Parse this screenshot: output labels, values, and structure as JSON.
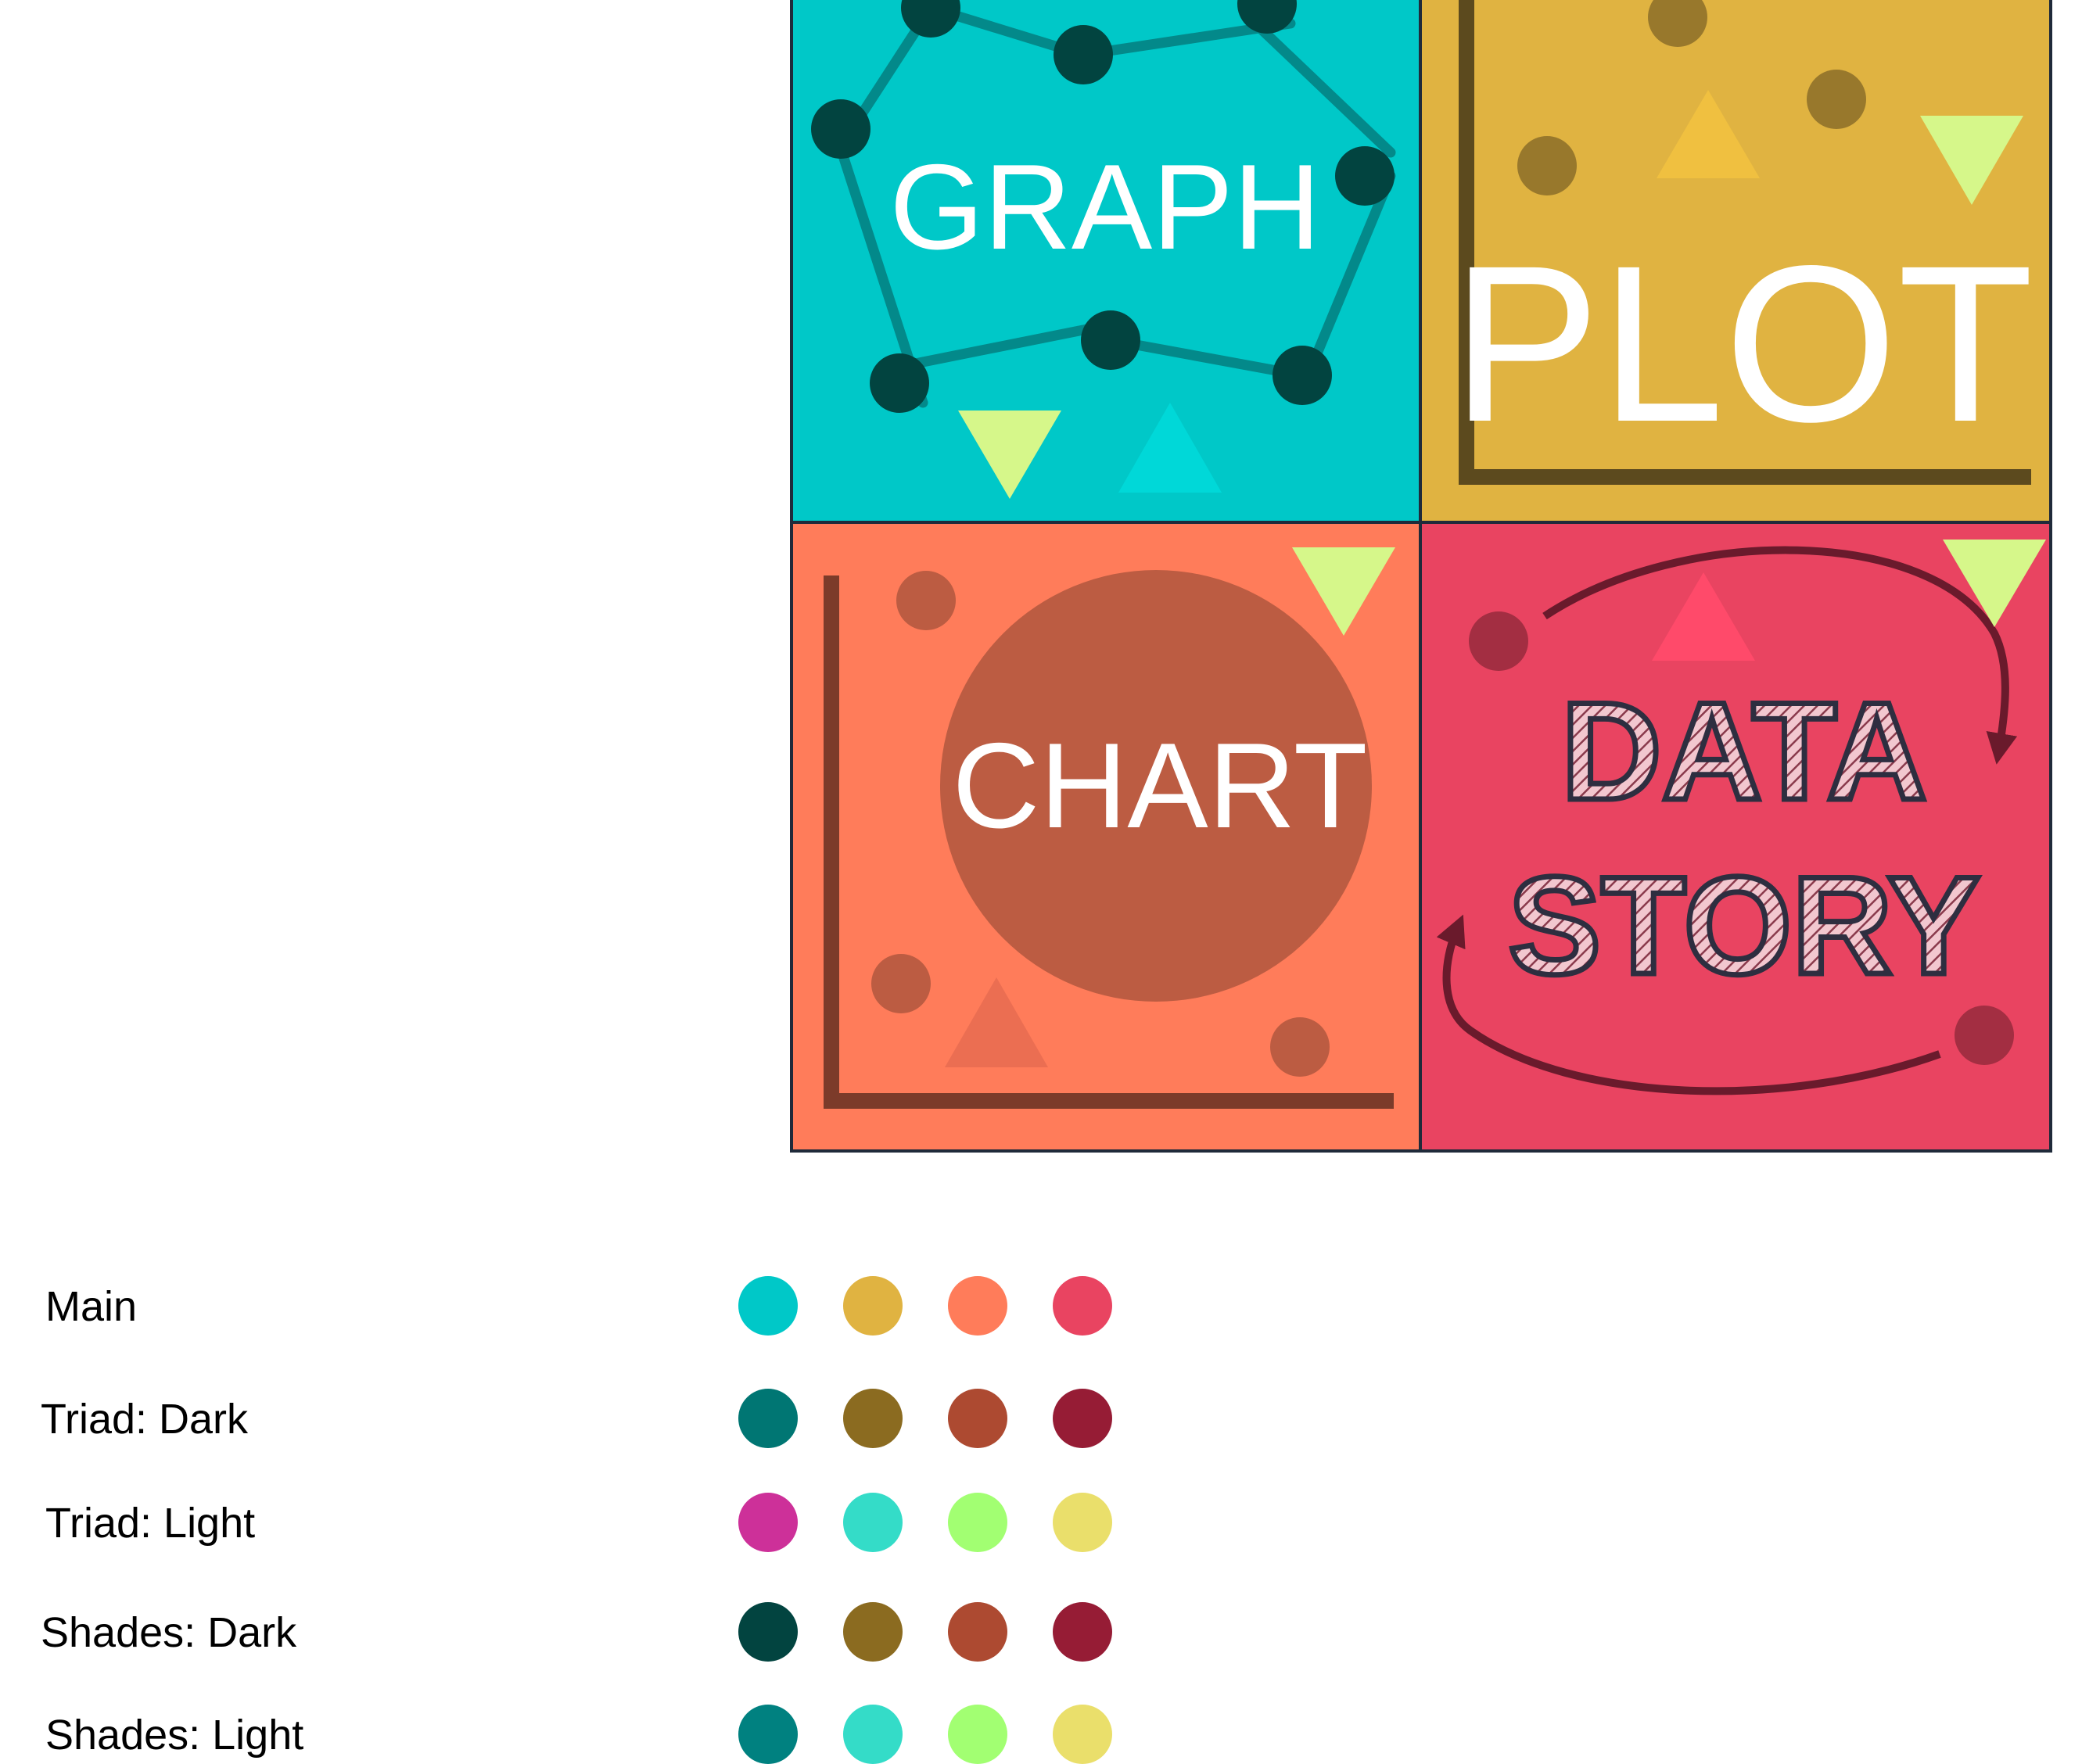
{
  "tiles": {
    "graph": {
      "label": "GRAPH",
      "bg": "#00C8C8",
      "node": "#024440",
      "edge": "#03898A"
    },
    "plot": {
      "label": "PLOT",
      "bg": "#E0B341",
      "axis": "#5C4A1E",
      "dot": "#98782C"
    },
    "chart": {
      "label": "CHART",
      "bg": "#FF7C5A",
      "circle": "#BC5C42",
      "axis": "#7C3B2A"
    },
    "data_story": {
      "line1": "DATA",
      "line2": "STORY",
      "bg": "#E94461",
      "arrow": "#6A1A2C",
      "dot": "#A32E42"
    }
  },
  "accent_triangle": "#D6F78A",
  "palette": [
    {
      "label": "Main",
      "colors": [
        "#00C8C8",
        "#E0B341",
        "#FF7C5A",
        "#E94461"
      ]
    },
    {
      "label": "Triad: Dark",
      "colors": [
        "#007673",
        "#8B6B20",
        "#AD4A31",
        "#961C35"
      ]
    },
    {
      "label": "Triad: Light",
      "colors": [
        "#CD3099",
        "#34DCC8",
        "#A2FF72",
        "#EADF6B"
      ]
    },
    {
      "label": "Shades: Dark",
      "colors": [
        "#024440",
        "#8B6B20",
        "#AD4A31",
        "#961C35"
      ]
    },
    {
      "label": "Shades: Light",
      "colors": [
        "#008180",
        "#34DCC8",
        "#A2FF72",
        "#EADF6B"
      ]
    }
  ]
}
